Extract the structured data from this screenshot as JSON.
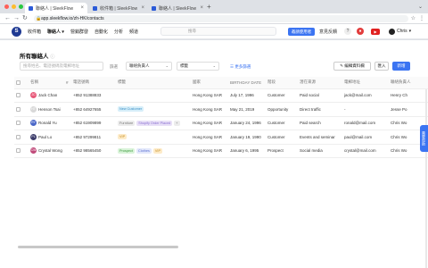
{
  "browser": {
    "tabs": [
      {
        "title": "聯絡人 | SleekFlow",
        "active": true
      },
      {
        "title": "收件箱 | SleekFlow",
        "active": false
      },
      {
        "title": "聯絡人 | SleekFlow",
        "active": false
      }
    ],
    "url": "app.sleekflow.io/zh-HK/contacts"
  },
  "nav": {
    "items": [
      "收件箱",
      "聯絡人",
      "營銷群發",
      "自動化",
      "分析",
      "頻道"
    ],
    "active_index": 1,
    "search_placeholder": "搜尋",
    "upgrade_label": "邀請使用者",
    "feedback_label": "意見反饋",
    "user_name": "Chris"
  },
  "contacts": {
    "title": "所有聯絡人",
    "search_placeholder": "搜尋姓名、電話號碼及電郵地址",
    "filter_label": "篩選",
    "assignee_select": "聯絡負責人",
    "tag_select": "標籤",
    "more_filters": "更多篩選",
    "edit_columns_button": "編輯資料欄",
    "import_button": "匯入",
    "new_button": "新增",
    "columns": [
      "名稱",
      "#",
      "電話號碼",
      "標籤",
      "國家",
      "BIRTHDAY DATE",
      "階段",
      "潛在來源",
      "電郵地址",
      "聯絡負責人"
    ],
    "rows": [
      {
        "name": "Jack Chan",
        "phone": "+852 91388833",
        "tags": [],
        "country": "Hong Kong SAR",
        "birthday": "July 17, 1996",
        "stage": "Customer",
        "source": "Paid social",
        "email": "jack@mail.com",
        "owner": "Henry Ch",
        "avatar_color": "#e85a7a",
        "initials": "JC"
      },
      {
        "name": "Henson Tsai",
        "phone": "+852 64927655",
        "tags": [
          {
            "label": "New Customer",
            "color": "#d6eef9",
            "text": "#3b8fc5"
          }
        ],
        "country": "Hong Kong SAR",
        "birthday": "May 21, 2019",
        "stage": "Opportunity",
        "source": "Direct traffic",
        "email": "-",
        "owner": "Jesse Po",
        "avatar_color": "#d8d8d8",
        "initials": "HT"
      },
      {
        "name": "Ronald Yu",
        "phone": "+852 61909899",
        "tags": [
          {
            "label": "Furniture",
            "color": "#ececec",
            "text": "#777"
          },
          {
            "label": "Shopify Order Placed",
            "color": "#e8e0f7",
            "text": "#8a6fd1"
          },
          {
            "label": "+",
            "color": "#ececec",
            "text": "#777"
          }
        ],
        "country": "Hong Kong SAR",
        "birthday": "January 24, 1996",
        "stage": "Customer",
        "source": "Paid search",
        "email": "ronald@mail.com",
        "owner": "Chris Wo",
        "avatar_color": "#4a67c8",
        "initials": "RY"
      },
      {
        "name": "Paul Lo",
        "phone": "+852 97299811",
        "tags": [
          {
            "label": "VIP",
            "color": "#fdebc8",
            "text": "#c48a1c"
          }
        ],
        "country": "Hong Kong SAR",
        "birthday": "January 19, 1990",
        "stage": "Customer",
        "source": "Events and seminar",
        "email": "paul@mail.com",
        "owner": "Chris Wo",
        "avatar_color": "#3d3d6b",
        "initials": "PL"
      },
      {
        "name": "Crystal Wong",
        "phone": "+852 98565450",
        "tags": [
          {
            "label": "Prospect",
            "color": "#d9f3d9",
            "text": "#3a9a3a"
          },
          {
            "label": "Clothes",
            "color": "#e3e8fb",
            "text": "#5b6fd1"
          },
          {
            "label": "VIP",
            "color": "#fdebc8",
            "text": "#c48a1c"
          }
        ],
        "country": "Hong Kong SAR",
        "birthday": "January 6, 1995",
        "stage": "Prospect",
        "source": "Social media",
        "email": "crystal@mail.com",
        "owner": "Chris Wo",
        "avatar_color": "#c04a7a",
        "initials": "CW"
      }
    ]
  },
  "side_tab_label": "需要幫助"
}
